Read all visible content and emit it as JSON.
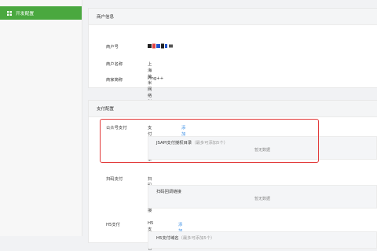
{
  "sidebar": {
    "items": [
      {
        "label": "开发配置",
        "icon": "grid-icon",
        "active": true
      }
    ]
  },
  "merchant_info": {
    "title": "商户信息",
    "rows": [
      {
        "label": "商户号",
        "value": ""
      },
      {
        "label": "商户名称",
        "value": "上海简米网络科技有限公司"
      },
      {
        "label": "商家简称",
        "value": "Ping++"
      }
    ]
  },
  "pay_config": {
    "title": "支付配置",
    "sections": [
      {
        "label": "公众号支付",
        "field": "支付授权目录",
        "add": "添加",
        "box_label": "JSAPI支付授权目录",
        "box_hint": "（最多可添加5个）",
        "empty": "暂无数据"
      },
      {
        "label": "扫码支付",
        "field": "扫码回调链接",
        "add": "",
        "box_label": "扫码回调链接",
        "box_hint": "",
        "empty": "暂无数据"
      },
      {
        "label": "H5支付",
        "field": "H5支付域名",
        "add": "添加",
        "box_label": "H5支付域名",
        "box_hint": "（最多可添加5个）",
        "empty": ""
      }
    ]
  },
  "colors": {
    "accent_green": "#4aa83f",
    "link_blue": "#3a8ee6",
    "highlight_red": "#e23b3b"
  }
}
